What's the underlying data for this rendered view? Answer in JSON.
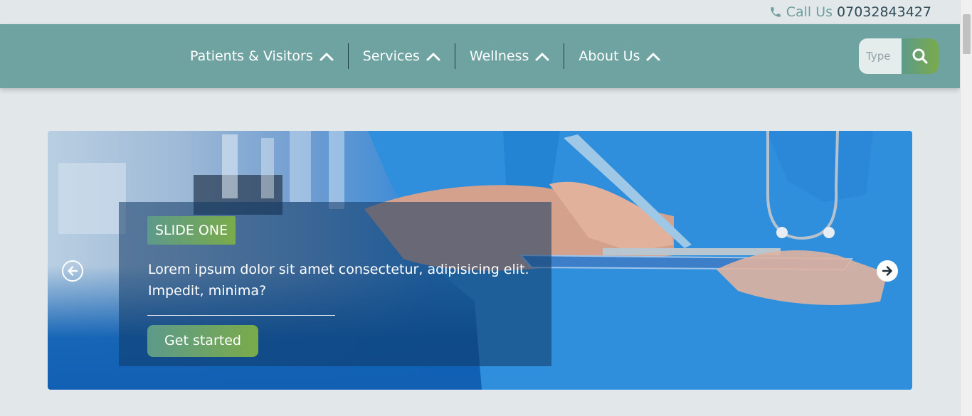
{
  "topbar": {
    "call_label": "Call Us",
    "phone_number": "07032843427",
    "icon": "phone-icon"
  },
  "nav": {
    "items": [
      {
        "label": "Patients & Visitors",
        "icon": "chevron-up-icon"
      },
      {
        "label": "Services",
        "icon": "chevron-up-icon"
      },
      {
        "label": "Wellness",
        "icon": "chevron-up-icon"
      },
      {
        "label": "About Us",
        "icon": "chevron-up-icon"
      }
    ]
  },
  "search": {
    "placeholder": "Type",
    "value": "",
    "icon": "search-icon"
  },
  "hero": {
    "badge": "SLIDE ONE",
    "text": "Lorem ipsum dolor sit amet consectetur, adipisicing elit. Impedit, minima?",
    "cta_label": "Get started",
    "prev_icon": "arrow-left-icon",
    "next_icon": "arrow-right-icon"
  },
  "colors": {
    "navbar": "#6fa3a1",
    "accent_start": "#5d9a8a",
    "accent_end": "#7aab4a",
    "page_background": "#e2e8e9"
  }
}
